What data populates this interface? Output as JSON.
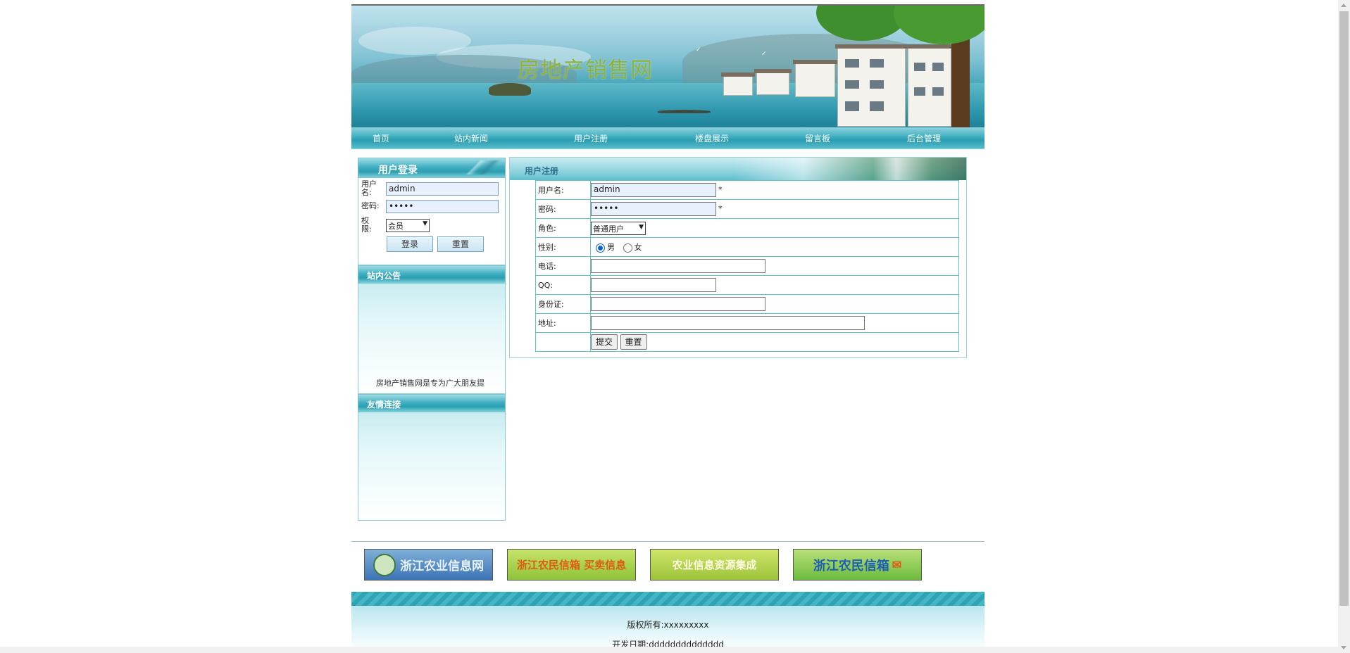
{
  "site": {
    "title": "房地产销售网"
  },
  "nav": [
    {
      "label": "首页"
    },
    {
      "label": "站内新闻"
    },
    {
      "label": "用户注册"
    },
    {
      "label": "楼盘展示"
    },
    {
      "label": "留言板"
    },
    {
      "label": "后台管理"
    }
  ],
  "login": {
    "title": "用户登录",
    "username_label": "用户名:",
    "username_value": "admin",
    "password_label": "密码:",
    "password_value": "•••••",
    "role_label": "权限:",
    "role_value": "会员",
    "login_button": "登录",
    "reset_button": "重置"
  },
  "notice": {
    "title": "站内公告",
    "text": "房地产销售网是专为广大朋友提"
  },
  "links": {
    "title": "友情连接"
  },
  "register": {
    "title": "用户注册",
    "username_label": "用户名:",
    "username_value": "admin",
    "password_label": "密码:",
    "password_value": "•••••",
    "required_mark": "*",
    "role_label": "角色:",
    "role_value": "普通用户",
    "gender_label": "性别:",
    "gender_male": "男",
    "gender_female": "女",
    "phone_label": "电话:",
    "qq_label": "QQ:",
    "id_label": "身份证:",
    "address_label": "地址:",
    "submit_button": "提交",
    "reset_button": "重置"
  },
  "partners": [
    {
      "label": "浙江农业信息网"
    },
    {
      "label": "浙江农民信箱 买卖信息"
    },
    {
      "label": "农业信息资源集成"
    },
    {
      "label": "浙江农民信箱"
    }
  ],
  "footer": {
    "copyright": "版权所有:xxxxxxxxx",
    "dev_date": "开发日期:dddddddddddddd"
  }
}
